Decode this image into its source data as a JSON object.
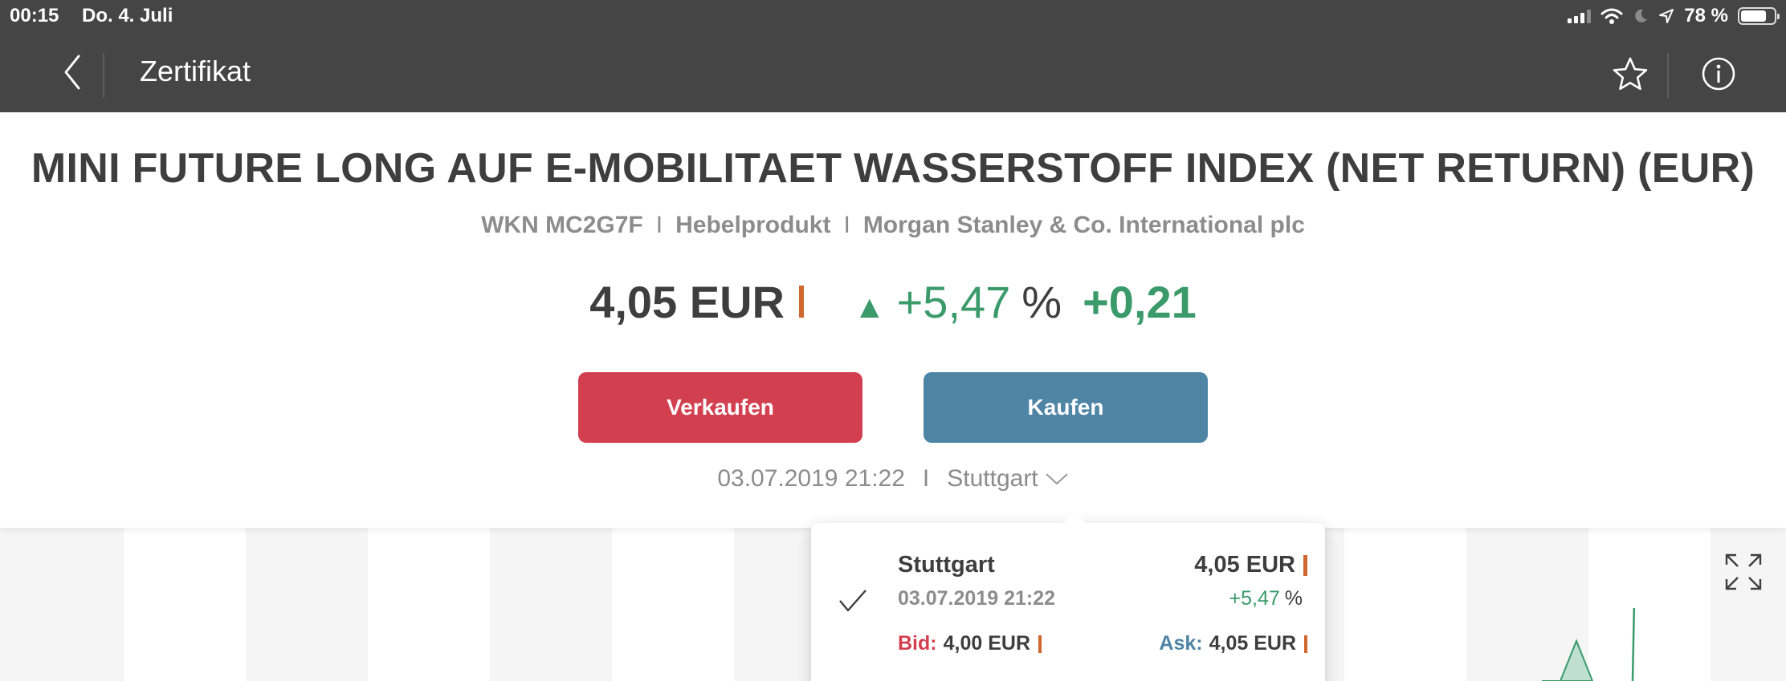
{
  "status_bar": {
    "time": "00:15",
    "date": "Do. 4. Juli",
    "battery": "78 %",
    "battery_level_percent": 78,
    "icons": [
      "signal-icon",
      "wifi-icon",
      "moon-icon",
      "location-arrow-icon",
      "battery-icon"
    ]
  },
  "nav": {
    "title": "Zertifikat",
    "back_icon": "chevron-left-icon",
    "star_icon": "star-icon",
    "info_icon": "info-icon"
  },
  "instrument": {
    "name": "MINI FUTURE LONG AUF E-MOBILITAET WASSERSTOFF INDEX (NET RETURN) (EUR)",
    "wkn": "WKN MC2G7F",
    "type": "Hebelprodukt",
    "issuer": "Morgan Stanley & Co. International plc",
    "price": "4,05 EUR",
    "change_pct": "+5,47",
    "pct_sign": "%",
    "change_abs": "+0,21",
    "up_indicator": "▲"
  },
  "actions": {
    "sell_label": "Verkaufen",
    "buy_label": "Kaufen"
  },
  "exchange": {
    "timestamp": "03.07.2019 21:22",
    "separator": "I",
    "selected": "Stuttgart"
  },
  "dropdown": {
    "items": [
      {
        "name": "Stuttgart",
        "date": "03.07.2019 21:22",
        "price": "4,05 EUR",
        "change_pct": "+5,47",
        "pct_sign": "%",
        "bid_label": "Bid:",
        "bid_value": "4,00 EUR",
        "ask_label": "Ask:",
        "ask_value": "4,05 EUR",
        "selected": true
      }
    ]
  },
  "colors": {
    "bar": "#454545",
    "sell": "#d2404f",
    "buy": "#4e84a4",
    "positive": "#3a9a6a",
    "realtime_marker": "#d0672f",
    "text_dark": "#3e3e3e",
    "text_muted": "#8c8c8c"
  }
}
